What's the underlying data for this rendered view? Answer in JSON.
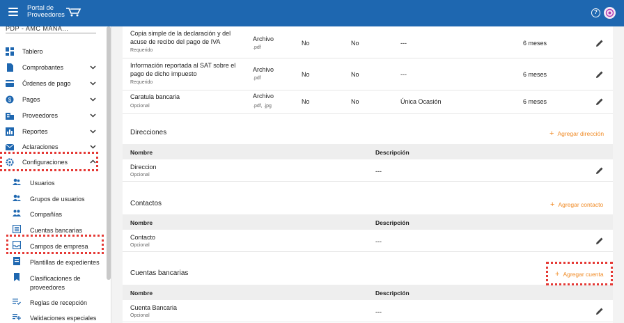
{
  "header": {
    "logo_line1": "Portal de",
    "logo_line2": "Proveedores"
  },
  "sidebar": {
    "supplier": "PDP - AMC MANA...",
    "items": [
      {
        "label": "Tablero"
      },
      {
        "label": "Comprobantes"
      },
      {
        "label": "Órdenes de pago"
      },
      {
        "label": "Pagos"
      },
      {
        "label": "Proveedores"
      },
      {
        "label": "Reportes"
      },
      {
        "label": "Aclaraciones"
      },
      {
        "label": "Configuraciones"
      }
    ],
    "subitems": [
      {
        "label": "Usuarios"
      },
      {
        "label": "Grupos de usuarios"
      },
      {
        "label": "Compañías"
      },
      {
        "label": "Cuentas bancarias"
      },
      {
        "label": "Campos de empresa"
      },
      {
        "label": "Plantillas de expedientes"
      },
      {
        "label": "Clasificaciones de proveedores"
      },
      {
        "label": "Reglas de recepción"
      },
      {
        "label": "Validaciones especiales"
      }
    ]
  },
  "documents": [
    {
      "name": "Copia simple de la declaración y del acuse de recibo del pago de IVA",
      "status": "Requerido",
      "type": "Archivo",
      "ext": ".pdf",
      "c1": "No",
      "c2": "No",
      "c3": "---",
      "c4": "6 meses"
    },
    {
      "name": "Información reportada al SAT sobre el pago de dicho impuesto",
      "status": "Requerido",
      "type": "Archivo",
      "ext": ".pdf",
      "c1": "No",
      "c2": "No",
      "c3": "---",
      "c4": "6 meses"
    },
    {
      "name": "Caratula bancaria",
      "status": "Opcional",
      "type": "Archivo",
      "ext": ".pdf, .jpg",
      "c1": "No",
      "c2": "No",
      "c3": "Única Ocasión",
      "c4": "6 meses"
    }
  ],
  "sections": {
    "direcciones": {
      "title": "Direcciones",
      "add": "Agregar dirección",
      "col1": "Nombre",
      "col2": "Descripción",
      "row_name": "Direccion",
      "row_status": "Opcional",
      "row_desc": "---"
    },
    "contactos": {
      "title": "Contactos",
      "add": "Agregar contacto",
      "col1": "Nombre",
      "col2": "Descripción",
      "row_name": "Contacto",
      "row_status": "Opcional",
      "row_desc": "---"
    },
    "cuentas": {
      "title": "Cuentas bancarias",
      "add": "Agregar cuenta",
      "col1": "Nombre",
      "col2": "Descripción",
      "row_name": "Cuenta Bancaria",
      "row_status": "Opcional",
      "row_desc": "---"
    }
  },
  "colors": {
    "header": "#1e67b0",
    "accent": "#f08a24",
    "highlight": "#e53935"
  },
  "icons": [
    "menu-icon",
    "help-icon",
    "pencil-icon",
    "chevron-down-icon",
    "chevron-up-icon",
    "gear-icon"
  ]
}
